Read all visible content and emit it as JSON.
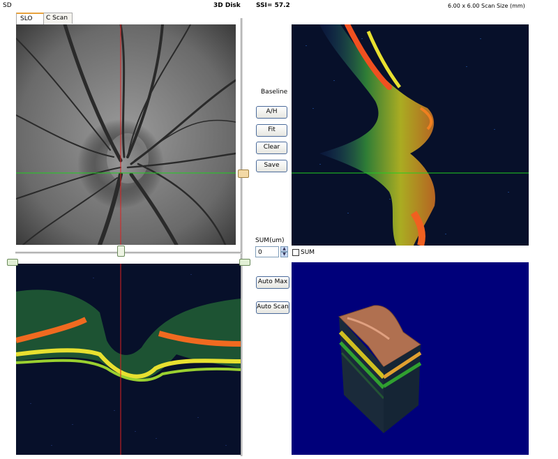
{
  "header": {
    "left_label": "SD",
    "mode": "3D Disk",
    "ssi": "SSI= 57.2",
    "scan_size": "6.00 x 6.00 Scan Size (mm)"
  },
  "tabs": [
    {
      "label": "SLO",
      "active": true
    },
    {
      "label": "C Scan",
      "active": false
    }
  ],
  "controls": {
    "baseline_label": "Baseline",
    "buttons": {
      "ah": "A/H",
      "fit": "Fit",
      "clear": "Clear",
      "save": "Save",
      "auto_max": "Auto Max",
      "auto_scan": "Auto Scan"
    },
    "sum_label": "SUM(um)",
    "sum_value": "0",
    "sum_checkbox_label": "SUM",
    "sum_checked": false
  },
  "colors": {
    "crosshair_vertical": "#e02020",
    "crosshair_horizontal": "#20d020",
    "scan_background": "#07102a",
    "view3d_background": "#00007a",
    "tab_accent": "#e8a23c"
  }
}
